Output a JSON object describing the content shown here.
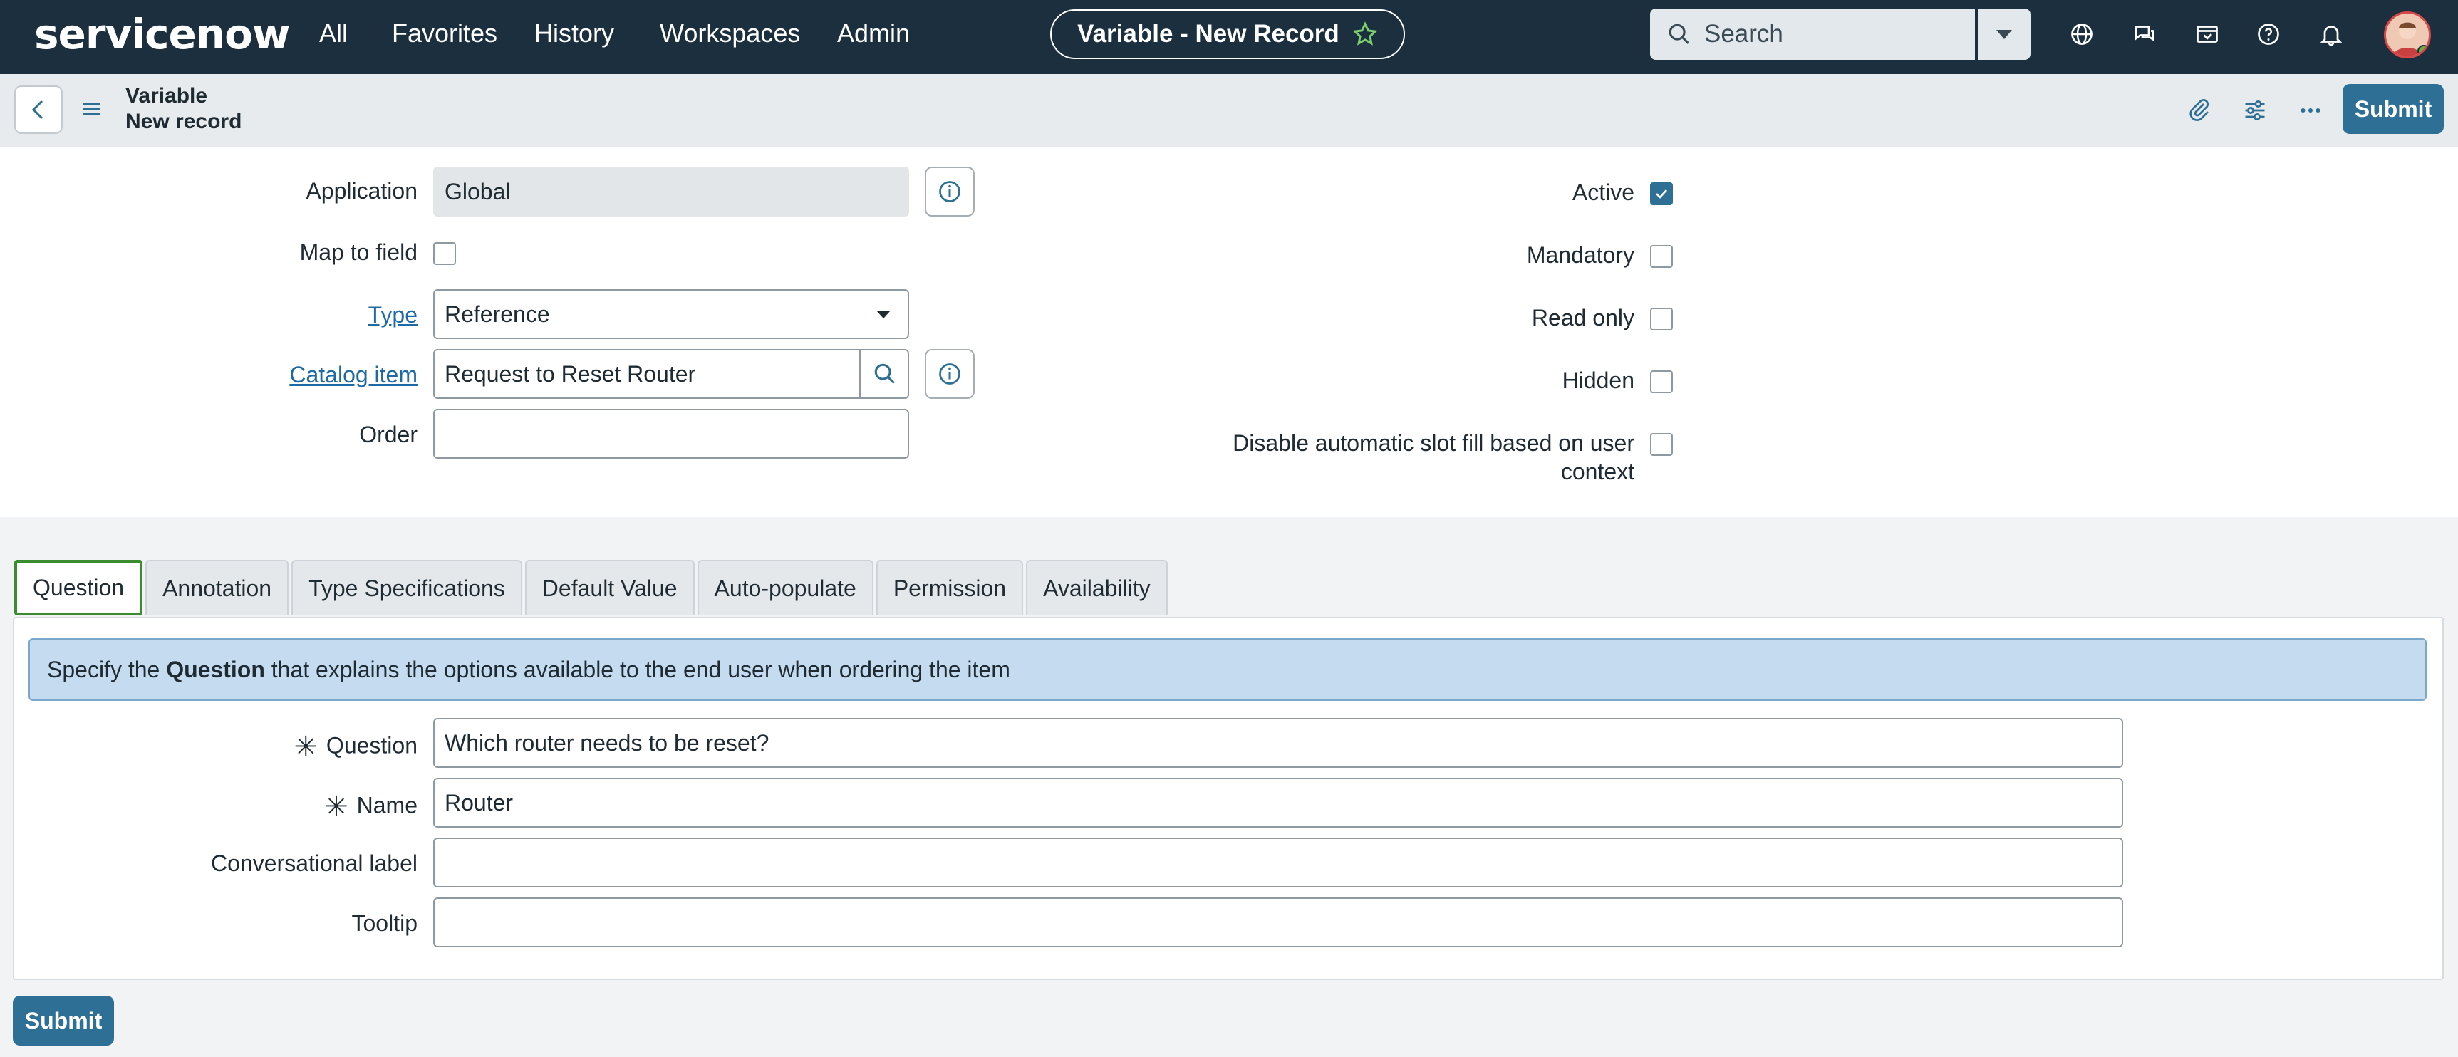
{
  "topnav": {
    "logo": "servicenow",
    "links": [
      "All",
      "Favorites",
      "History",
      "Workspaces",
      "Admin"
    ],
    "record_title": "Variable - New Record",
    "search_placeholder": "Search"
  },
  "subheader": {
    "title_line1": "Variable",
    "title_line2": "New record",
    "submit_label": "Submit"
  },
  "form": {
    "application_label": "Application",
    "application_value": "Global",
    "map_to_field_label": "Map to field",
    "type_label": "Type",
    "type_value": "Reference",
    "catalog_item_label": "Catalog item",
    "catalog_item_value": "Request to Reset Router",
    "order_label": "Order",
    "order_value": "",
    "active_label": "Active",
    "active_checked": true,
    "mandatory_label": "Mandatory",
    "read_only_label": "Read only",
    "hidden_label": "Hidden",
    "disable_slot_label_line1": "Disable automatic slot fill based on user",
    "disable_slot_label_line2": "context"
  },
  "tabs": [
    "Question",
    "Annotation",
    "Type Specifications",
    "Default Value",
    "Auto-populate",
    "Permission",
    "Availability"
  ],
  "question_tab": {
    "banner_prefix": "Specify the ",
    "banner_bold": "Question",
    "banner_suffix": " that explains the options available to the end user when ordering the item",
    "question_label": "Question",
    "question_value": "Which router needs to be reset?",
    "name_label": "Name",
    "name_value": "Router",
    "conversational_label": "Conversational label",
    "conversational_value": "",
    "tooltip_label": "Tooltip",
    "tooltip_value": ""
  },
  "bottom": {
    "submit_label": "Submit"
  },
  "colors": {
    "nav_bg": "#1b2f3e",
    "primary": "#2e6f95",
    "active_tab_border": "#3b8b2f",
    "banner_bg": "#c5dcf0"
  }
}
